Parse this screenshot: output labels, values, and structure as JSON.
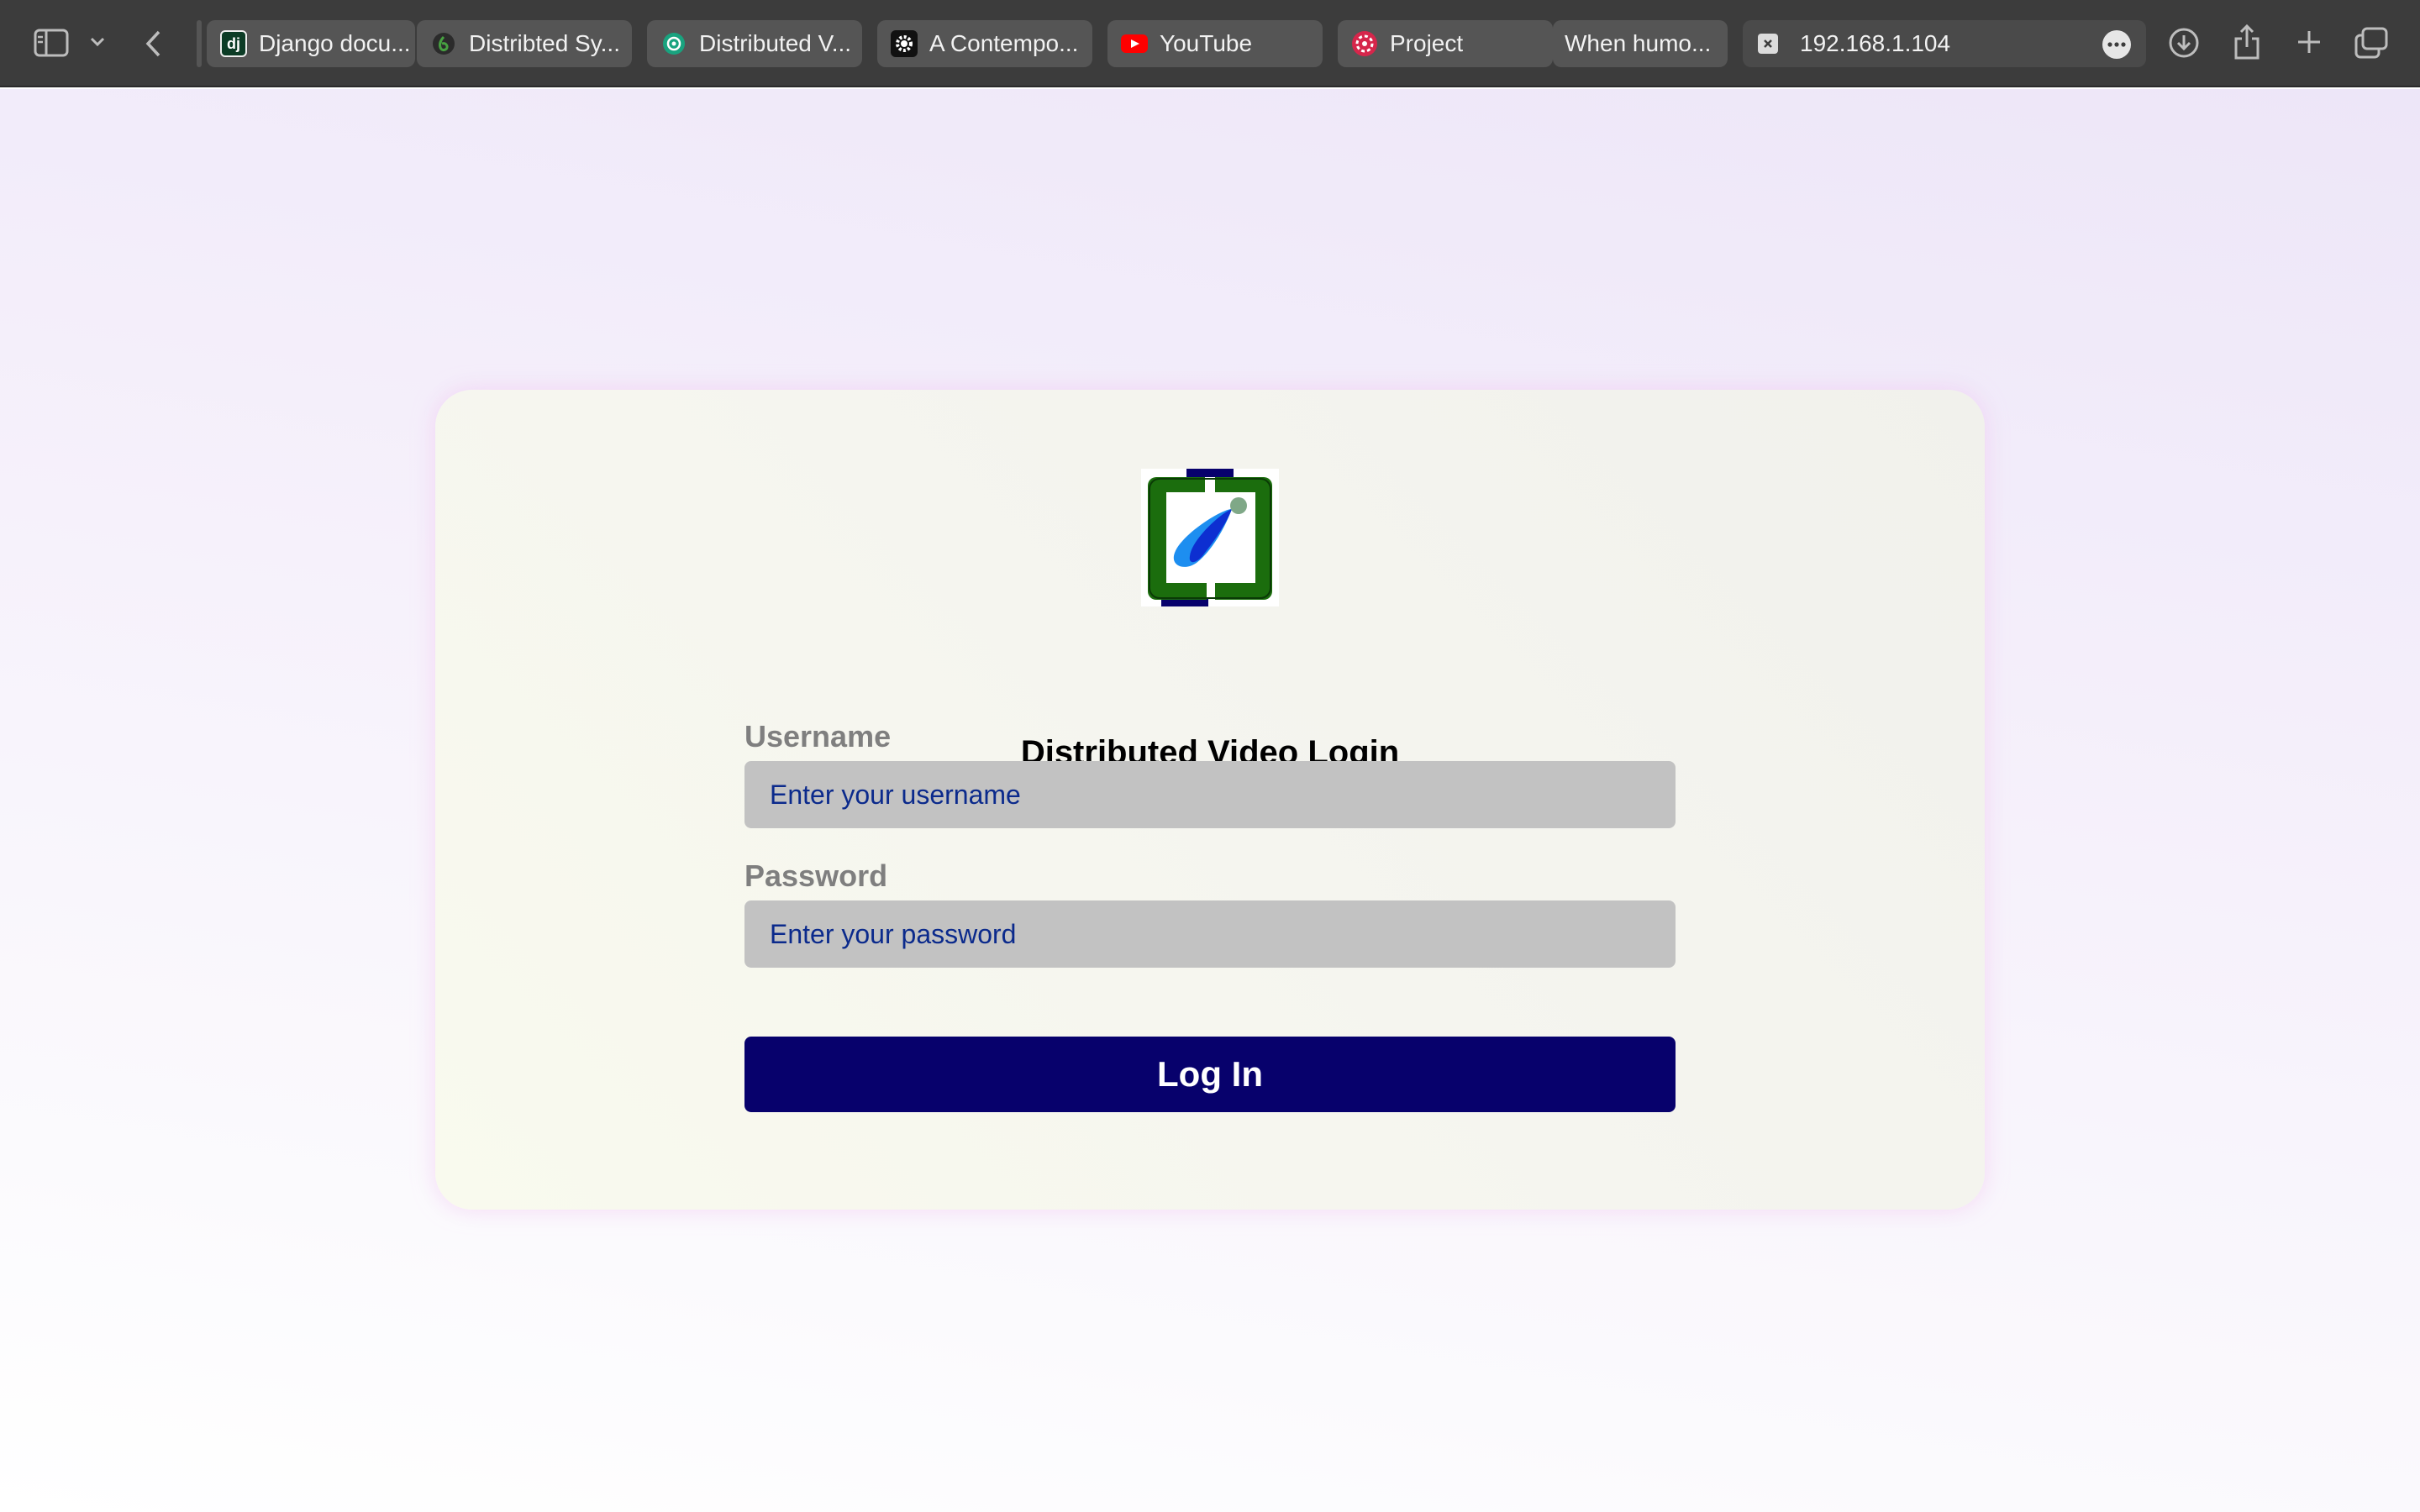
{
  "browser": {
    "tabs": [
      {
        "label": "Django docu...",
        "icon": "django-icon"
      },
      {
        "label": "Distribted Sy...",
        "icon": "overleaf-icon"
      },
      {
        "label": "Distributed V...",
        "icon": "chatgpt-icon"
      },
      {
        "label": "A Contempo...",
        "icon": "gear-icon"
      },
      {
        "label": "YouTube",
        "icon": "youtube-icon"
      },
      {
        "label": "Project",
        "icon": "project-icon"
      },
      {
        "label": "When humo...",
        "icon": ""
      }
    ],
    "address": "192.168.1.104",
    "favicon_text": {
      "django": "dj"
    }
  },
  "login": {
    "title": "Distributed Video Login",
    "username_label": "Username",
    "username_placeholder": "Enter your username",
    "password_label": "Password",
    "password_placeholder": "Enter your password",
    "submit_label": "Log In"
  },
  "colors": {
    "button": "#07016c",
    "input_bg": "#c2c2c2",
    "label": "#7f7f7f",
    "logo_green": "#1b6d0d",
    "logo_navy": "#07016c",
    "logo_blue": "#1f6fe8"
  }
}
